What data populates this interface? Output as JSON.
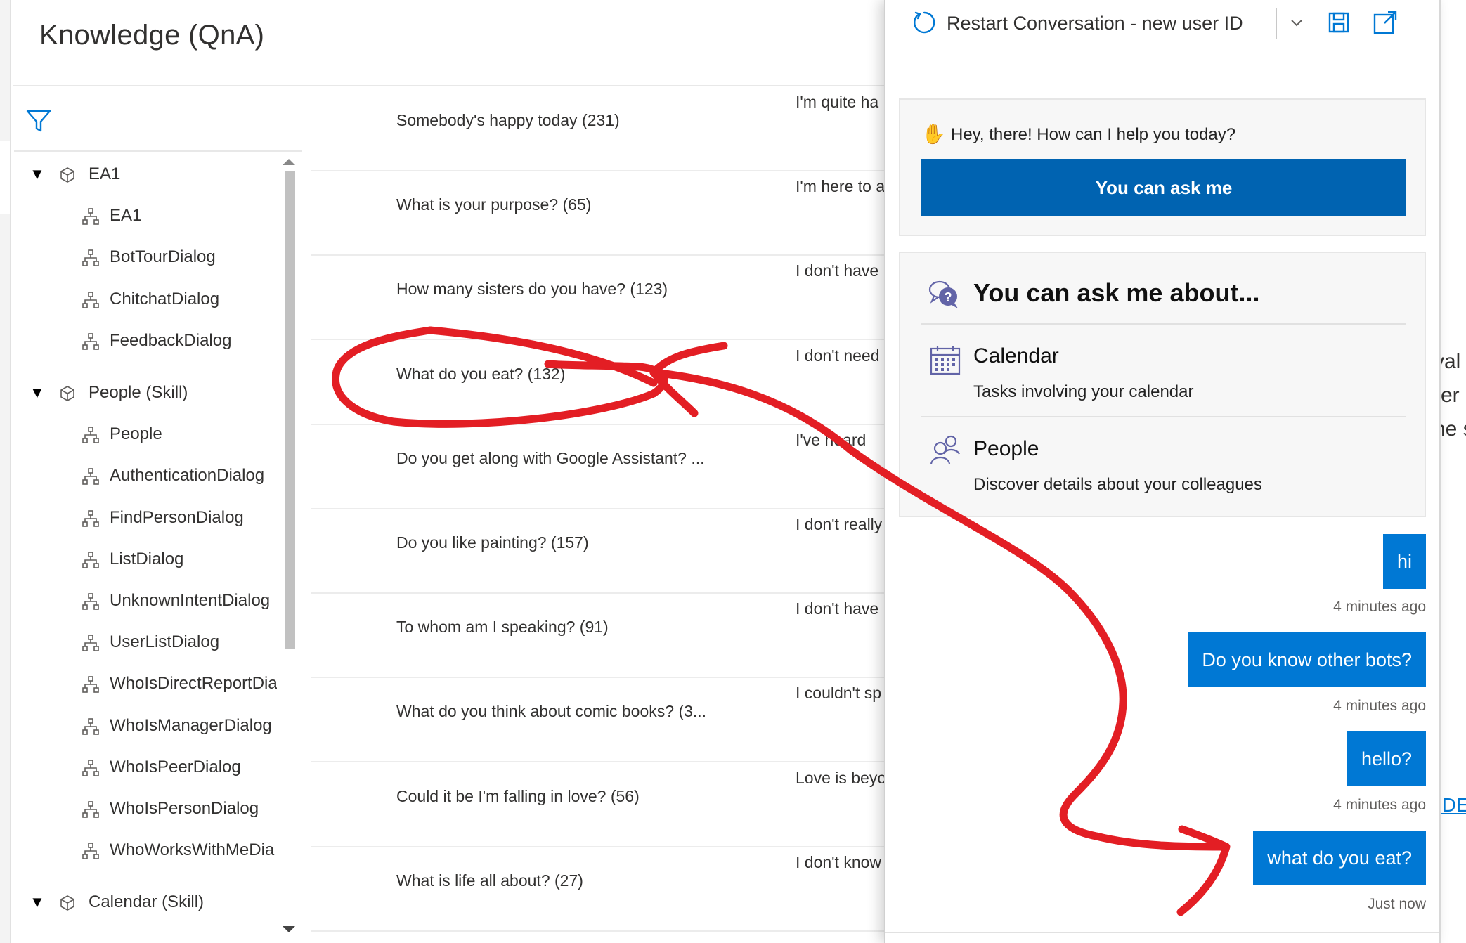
{
  "page": {
    "title": "Knowledge (QnA)"
  },
  "nav": {
    "groups": [
      {
        "label": "EA1",
        "children": [
          "EA1",
          "BotTourDialog",
          "ChitchatDialog",
          "FeedbackDialog"
        ]
      },
      {
        "label": "People (Skill)",
        "children": [
          "People",
          "AuthenticationDialog",
          "FindPersonDialog",
          "ListDialog",
          "UnknownIntentDialog",
          "UserListDialog",
          "WhoIsDirectReportDia",
          "WhoIsManagerDialog",
          "WhoIsPeerDialog",
          "WhoIsPersonDialog",
          "WhoWorksWithMeDia"
        ]
      },
      {
        "label": "Calendar (Skill)",
        "children": []
      }
    ]
  },
  "qna": {
    "rows": [
      {
        "question": "Somebody's happy today  (231)",
        "answer": "I'm quite ha"
      },
      {
        "question": "What is your purpose?  (65)",
        "answer": "I'm here to a"
      },
      {
        "question": "How many sisters do you have?  (123)",
        "answer": "I don't have"
      },
      {
        "question": "What do you eat?  (132)",
        "answer": "I don't need"
      },
      {
        "question": "Do you get along with Google Assistant?  ...",
        "answer": "I've heard"
      },
      {
        "question": "Do you like painting?  (157)",
        "answer": "I don't really"
      },
      {
        "question": "To whom am I speaking?  (91)",
        "answer": "I don't have"
      },
      {
        "question": "What do you think about comic books?  (3...",
        "answer": "I couldn't sp"
      },
      {
        "question": "Could it be I'm falling in love?  (56)",
        "answer": "Love is beyo"
      },
      {
        "question": "What is life all about?  (27)",
        "answer": "I don't know"
      }
    ]
  },
  "background_text": {
    "lines": [
      "val",
      "rer",
      "he s"
    ],
    "link": "IDE"
  },
  "emulator": {
    "restart_label": "Restart Conversation - new user ID",
    "greeting_card": {
      "text": "Hey, there! How can I help you today?",
      "button": "You can ask me"
    },
    "about_card": {
      "heading": "You can ask me about...",
      "items": [
        {
          "title": "Calendar",
          "description": "Tasks involving your calendar",
          "icon": "calendar-icon"
        },
        {
          "title": "People",
          "description": "Discover details about your colleagues",
          "icon": "people-icon"
        }
      ]
    },
    "messages": [
      {
        "text": "hi",
        "time": "4 minutes ago"
      },
      {
        "text": "Do you know other bots?",
        "time": "4 minutes ago"
      },
      {
        "text": "hello?",
        "time": "4 minutes ago"
      },
      {
        "text": "what do you eat?",
        "time": "Just now"
      }
    ]
  },
  "colors": {
    "accent": "#0078d4",
    "button": "#0063b1",
    "annotation": "#e31e24"
  }
}
